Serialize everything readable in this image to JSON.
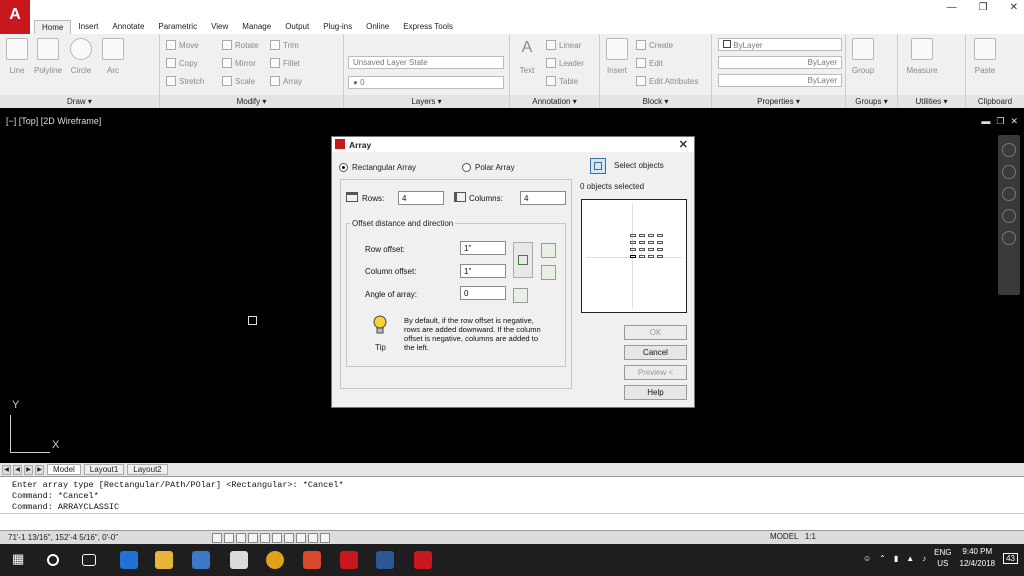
{
  "menu": {
    "tabs": [
      "Home",
      "Insert",
      "Annotate",
      "Parametric",
      "View",
      "Manage",
      "Output",
      "Plug-ins",
      "Online",
      "Express Tools"
    ]
  },
  "ribbon": {
    "draw": {
      "title": "Draw",
      "line": "Line",
      "polyline": "Polyline",
      "circle": "Circle",
      "arc": "Arc"
    },
    "modify": {
      "title": "Modify",
      "move": "Move",
      "rotate": "Rotate",
      "trim": "Trim",
      "copy": "Copy",
      "mirror": "Mirror",
      "fillet": "Fillet",
      "stretch": "Stretch",
      "scale": "Scale",
      "array": "Array"
    },
    "layers": {
      "title": "Layers",
      "layer_state": "Unsaved Layer State",
      "current_layer": "0"
    },
    "annotation": {
      "title": "Annotation",
      "text": "Text",
      "linear": "Linear",
      "leader": "Leader",
      "table": "Table"
    },
    "block": {
      "title": "Block",
      "insert": "Insert",
      "create": "Create",
      "edit": "Edit",
      "edit_attributes": "Edit Attributes"
    },
    "properties": {
      "title": "Properties",
      "color": "ByLayer",
      "linetype": "ByLayer",
      "lineweight": "ByLayer"
    },
    "groups": {
      "title": "Groups",
      "group": "Group"
    },
    "utilities": {
      "title": "Utilities",
      "measure": "Measure"
    },
    "clipboard": {
      "title": "Clipboard",
      "paste": "Paste"
    }
  },
  "viewport": {
    "label": "[−] [Top] [2D Wireframe]",
    "ucs_x": "X",
    "ucs_y": "Y"
  },
  "layout_tabs": [
    "Model",
    "Layout1",
    "Layout2"
  ],
  "command_history": [
    "Enter array type [Rectangular/PAth/POlar] <Rectangular>: *Cancel*",
    "Command: *Cancel*",
    "Command: ARRAYCLASSIC"
  ],
  "status": {
    "coords": "71'-1 13/16\", 152'-4 5/16\", 0'-0\"",
    "model": "MODEL",
    "scale": "1:1"
  },
  "tray": {
    "lang": "ENG",
    "region": "US",
    "time": "9:40 PM",
    "date": "12/4/2018",
    "notifications": "43"
  },
  "dialog": {
    "title": "Array",
    "rect_label": "Rectangular Array",
    "polar_label": "Polar Array",
    "rows_label": "Rows:",
    "rows_value": "4",
    "cols_label": "Columns:",
    "cols_value": "4",
    "offset_title": "Offset distance and direction",
    "row_offset_label": "Row offset:",
    "row_offset_value": "1\"",
    "col_offset_label": "Column offset:",
    "col_offset_value": "1\"",
    "angle_label": "Angle of array:",
    "angle_value": "0",
    "tip_label": "Tip",
    "tip_text": "By default, if the row offset is negative, rows are added downward.  If the column offset is negative, columns are added to the left.",
    "select_label": "Select objects",
    "selected_count": "0 objects selected",
    "ok": "OK",
    "cancel": "Cancel",
    "preview": "Preview <",
    "help": "Help"
  }
}
